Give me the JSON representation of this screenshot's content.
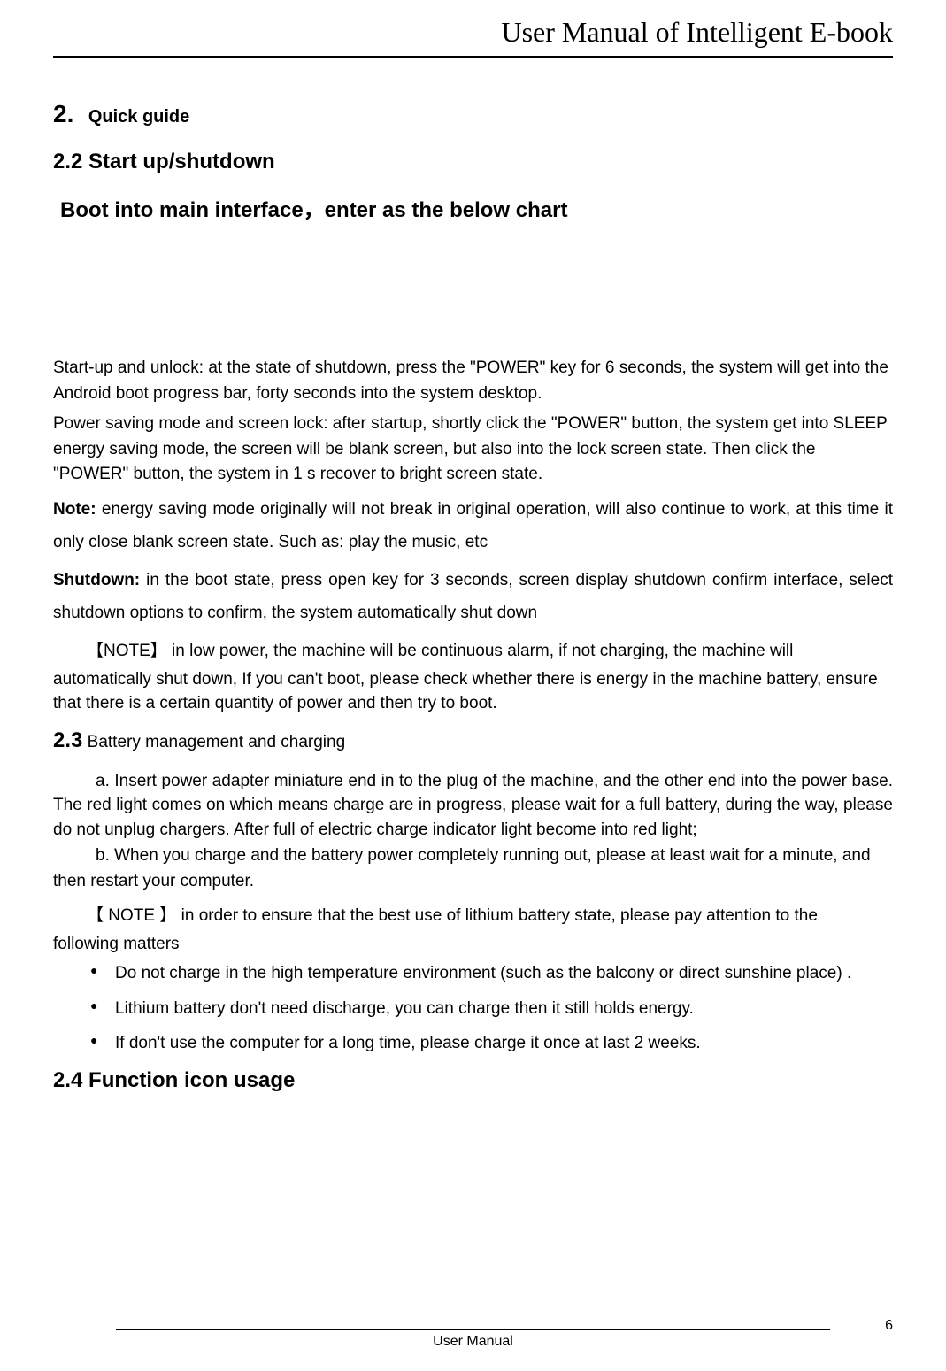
{
  "header": {
    "title": "User Manual of Intelligent E-book"
  },
  "section2": {
    "num": "2.",
    "label": "Quick guide"
  },
  "section22": {
    "heading": "2.2 Start up/shutdown",
    "subheading": "Boot into main interface，enter as the below chart",
    "para1": "Start-up and unlock: at the state of shutdown, press the \"POWER\" key for 6 seconds, the system will get into the Android boot progress bar, forty seconds into the system desktop.",
    "para2": "Power saving mode and screen lock: after startup, shortly click the \"POWER\" button, the system get into SLEEP energy saving mode, the screen will be blank screen, but also into the lock screen state. Then click the \"POWER\" button, the system in 1 s recover to bright screen state.",
    "note_label": "Note:",
    "note_text": " energy saving mode originally will not break in original operation, will also continue to work, at this time it only close blank screen state. Such as: play the music, etc",
    "shutdown_label": "Shutdown:",
    "shutdown_text": " in the boot state, press open key for 3 seconds, screen display shutdown confirm interface, select shutdown options to confirm, the system automatically shut down",
    "note2_prefix": "【NOTE】",
    "note2_text": "  in low power, the machine will be continuous alarm, if not charging, the machine will",
    "note2_cont": "automatically shut down, If you can't boot, please check whether there is energy in the machine battery, ensure that there is a certain quantity of power and then try to boot."
  },
  "section23": {
    "num": "2.3",
    "label": " Battery management and charging",
    "para_a": "a. Insert power adapter miniature end in to the plug of the machine, and the other end into the power base. The red light comes on which means charge are in progress, please wait for a full battery, during the way, please do not unplug chargers. After full of electric charge indicator light become into red light;",
    "para_b": "b. When you charge and the battery power completely running out, please at least wait for a minute, and then restart your computer.",
    "note_prefix": "【 NOTE 】",
    "note_text": "  in order to ensure that the best use of lithium battery state, please pay attention to the",
    "note_cont": "following matters",
    "bullets": [
      "Do not charge in the high temperature environment (such as the balcony or direct sunshine place) .",
      "Lithium battery don't need discharge, you can charge then it still holds energy.",
      "If don't use the computer for a long time, please charge it once at last 2 weeks."
    ]
  },
  "section24": {
    "heading": "2.4 Function icon usage"
  },
  "footer": {
    "label": "User Manual",
    "page": "6"
  }
}
